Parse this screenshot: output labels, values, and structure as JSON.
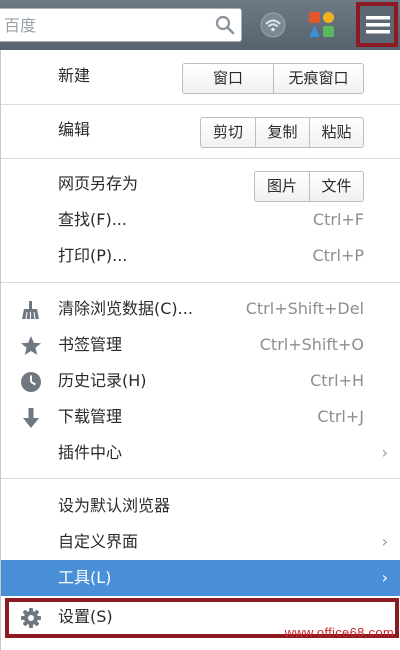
{
  "toolbar": {
    "search_placeholder": "百度",
    "colors": {
      "background": "#5f6b76",
      "highlight_border": "#8b1a22"
    }
  },
  "menu": {
    "new_row": {
      "label": "新建",
      "buttons": [
        "窗口",
        "无痕窗口"
      ]
    },
    "edit_row": {
      "label": "编辑",
      "buttons": [
        "剪切",
        "复制",
        "粘贴"
      ]
    },
    "save_row": {
      "label": "网页另存为",
      "buttons": [
        "图片",
        "文件"
      ]
    },
    "find": {
      "label": "查找(F)...",
      "shortcut": "Ctrl+F"
    },
    "print": {
      "label": "打印(P)...",
      "shortcut": "Ctrl+P"
    },
    "clear_data": {
      "label": "清除浏览数据(C)...",
      "shortcut": "Ctrl+Shift+Del",
      "icon": "broom-icon"
    },
    "bookmarks": {
      "label": "书签管理",
      "shortcut": "Ctrl+Shift+O",
      "icon": "star-icon"
    },
    "history": {
      "label": "历史记录(H)",
      "shortcut": "Ctrl+H",
      "icon": "clock-icon"
    },
    "downloads": {
      "label": "下载管理",
      "shortcut": "Ctrl+J",
      "icon": "download-arrow-icon"
    },
    "plugins": {
      "label": "插件中心",
      "chevron": "›"
    },
    "default_browser": {
      "label": "设为默认浏览器"
    },
    "customize": {
      "label": "自定义界面",
      "chevron": "›"
    },
    "tools": {
      "label": "工具(L)",
      "chevron": "›",
      "highlight_color": "#4a90d9"
    },
    "settings": {
      "label": "设置(S)",
      "icon": "gear-icon"
    }
  },
  "watermark": "www.office68.com"
}
